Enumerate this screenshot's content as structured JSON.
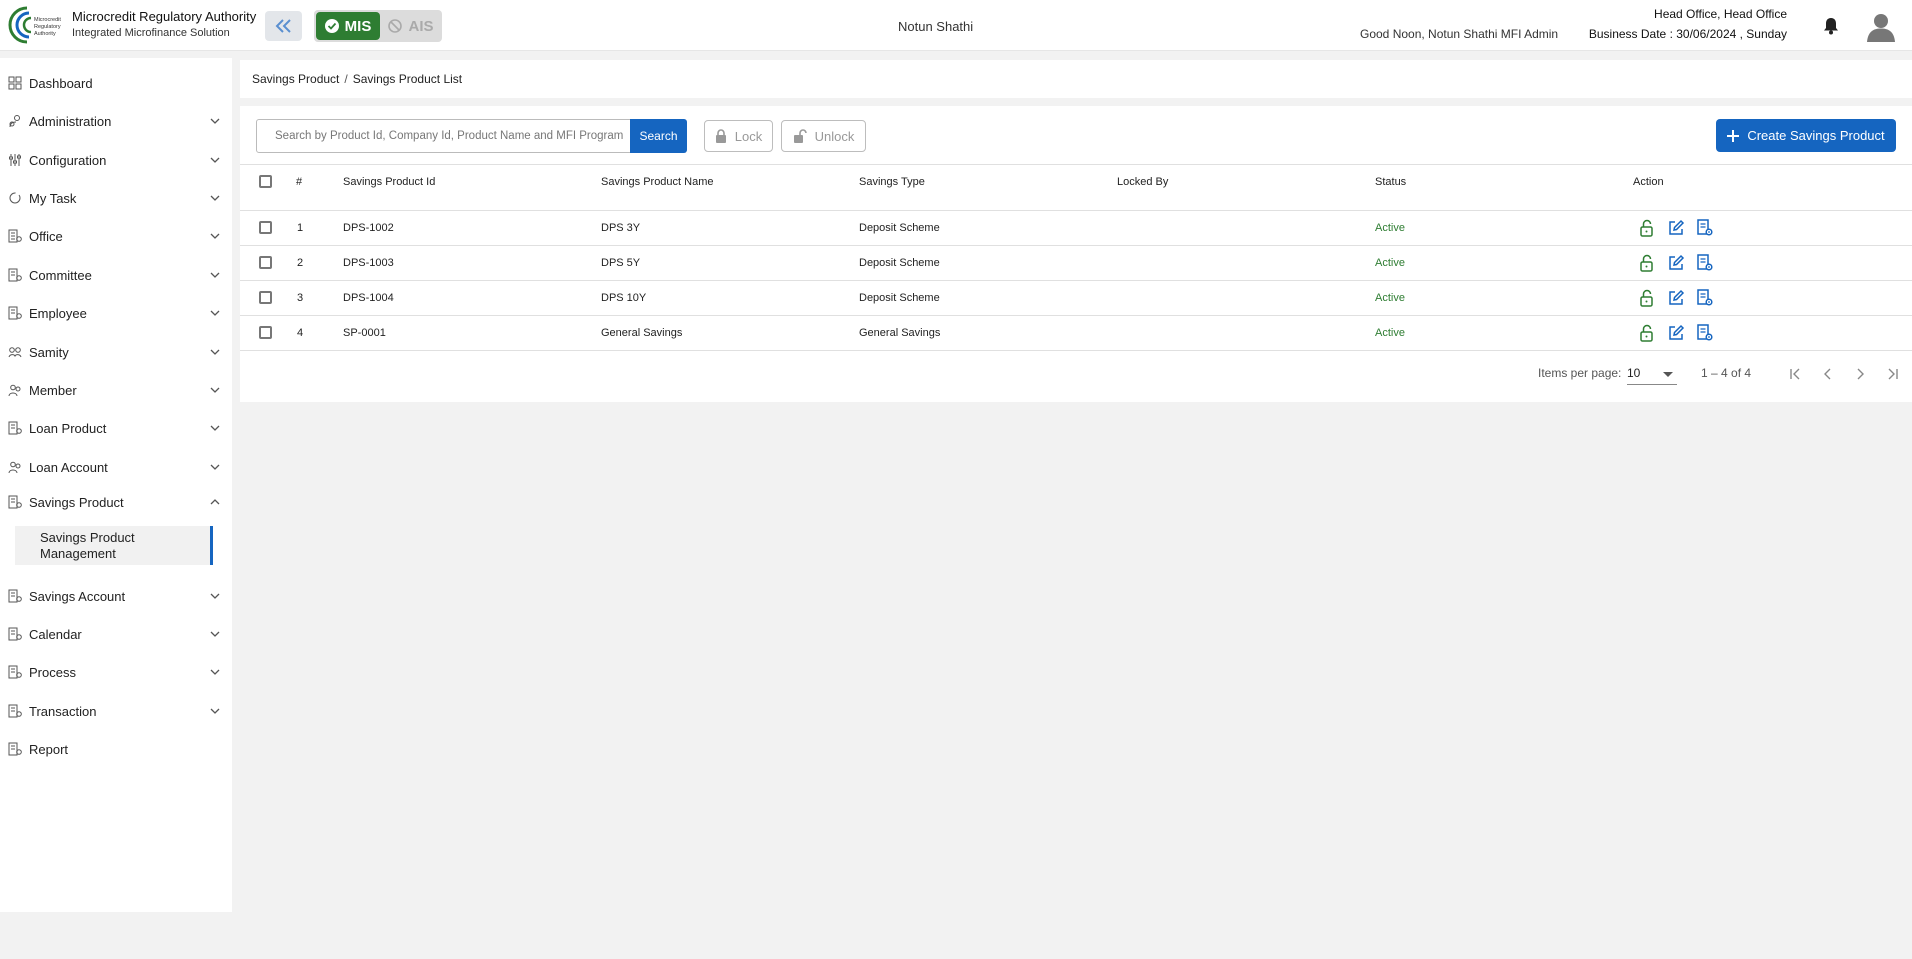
{
  "header": {
    "org_name": "Microcredit Regulatory Authority",
    "org_sub": "Integrated Microfinance Solution",
    "logo_text": "Microcredit Regulatory Authority",
    "mis_label": "MIS",
    "ais_label": "AIS",
    "center_title": "Notun Shathi",
    "greeting": "Good Noon, Notun Shathi MFI Admin",
    "office": "Head Office, Head Office",
    "business_date": "Business Date : 30/06/2024 , Sunday"
  },
  "sidebar": {
    "items": [
      {
        "label": "Dashboard",
        "icon": "grid-icon"
      },
      {
        "label": "Administration",
        "icon": "admin-icon"
      },
      {
        "label": "Configuration",
        "icon": "sliders-icon"
      },
      {
        "label": "My Task",
        "icon": "refresh-icon"
      },
      {
        "label": "Office",
        "icon": "office-icon"
      },
      {
        "label": "Committee",
        "icon": "committee-icon"
      },
      {
        "label": "Employee",
        "icon": "employee-icon"
      },
      {
        "label": "Samity",
        "icon": "samity-icon"
      },
      {
        "label": "Member",
        "icon": "member-icon"
      },
      {
        "label": "Loan Product",
        "icon": "loan-product-icon"
      },
      {
        "label": "Loan Account",
        "icon": "loan-account-icon"
      },
      {
        "label": "Savings Product",
        "icon": "savings-product-icon"
      },
      {
        "label": "Savings Account",
        "icon": "savings-account-icon"
      },
      {
        "label": "Calendar",
        "icon": "calendar-icon"
      },
      {
        "label": "Process",
        "icon": "process-icon"
      },
      {
        "label": "Transaction",
        "icon": "transaction-icon"
      },
      {
        "label": "Report",
        "icon": "report-icon"
      }
    ],
    "sub_item": "Savings Product Management"
  },
  "breadcrumb": {
    "parent": "Savings Product",
    "separator": "/",
    "current": "Savings Product List"
  },
  "toolbar": {
    "search_placeholder": "Search by Product Id, Company Id, Product Name and MFI Program",
    "search_label": "Search",
    "lock_label": "Lock",
    "unlock_label": "Unlock",
    "create_label": "Create Savings Product"
  },
  "table": {
    "headers": [
      "#",
      "Savings Product Id",
      "Savings Product Name",
      "Savings Type",
      "Locked By",
      "Status",
      "Action"
    ],
    "rows": [
      {
        "num": "1",
        "id": "DPS-1002",
        "name": "DPS 3Y",
        "type": "Deposit Scheme",
        "locked_by": "",
        "status": "Active"
      },
      {
        "num": "2",
        "id": "DPS-1003",
        "name": "DPS 5Y",
        "type": "Deposit Scheme",
        "locked_by": "",
        "status": "Active"
      },
      {
        "num": "3",
        "id": "DPS-1004",
        "name": "DPS 10Y",
        "type": "Deposit Scheme",
        "locked_by": "",
        "status": "Active"
      },
      {
        "num": "4",
        "id": "SP-0001",
        "name": "General Savings",
        "type": "General Savings",
        "locked_by": "",
        "status": "Active"
      }
    ]
  },
  "paginator": {
    "items_label": "Items per page:",
    "page_size": "10",
    "range": "1 – 4 of 4"
  },
  "colors": {
    "primary": "#1565c0",
    "active_green": "#2e7d32",
    "mis_green": "#2e7d32"
  }
}
